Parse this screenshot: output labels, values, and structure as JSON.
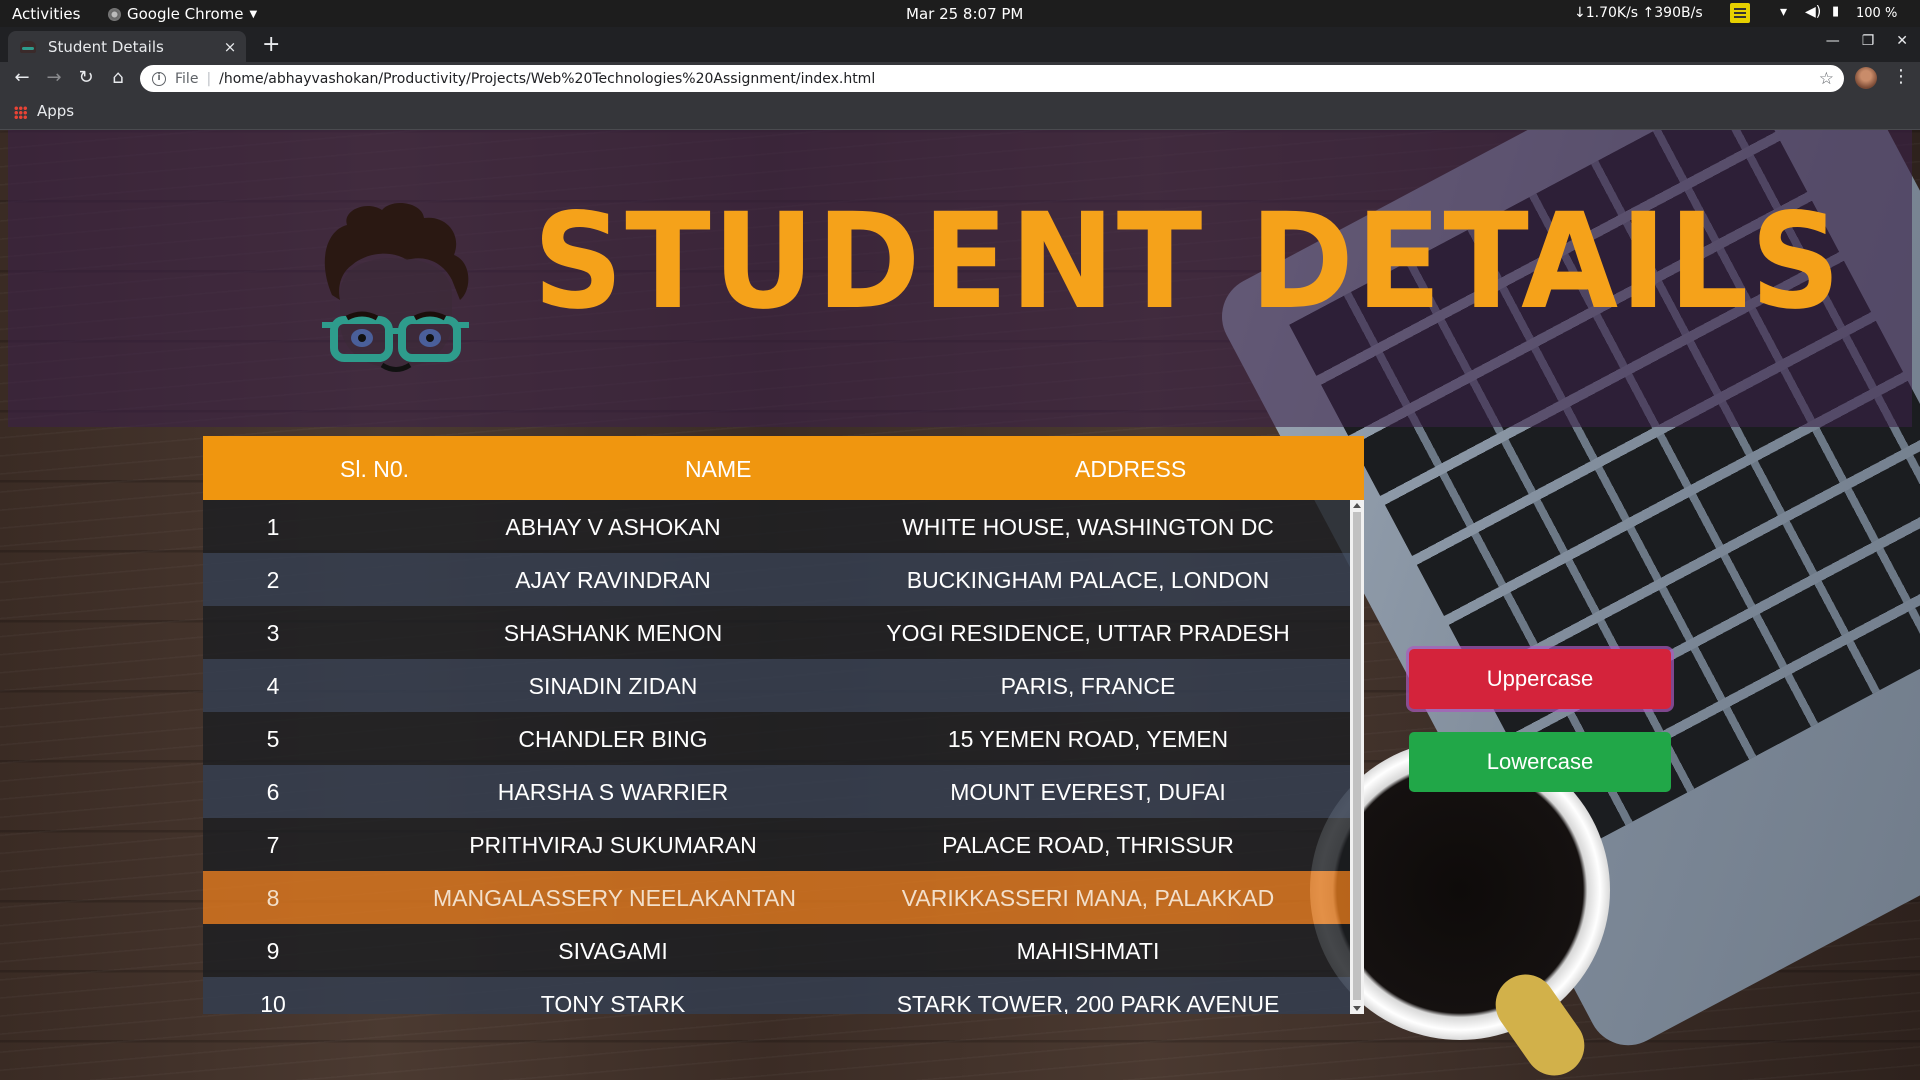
{
  "system_bar": {
    "activities": "Activities",
    "app_name": "Google Chrome",
    "clock": "Mar 25  8:07 PM",
    "network": "↓1.70K/s ↑390B/s",
    "battery": "100 %"
  },
  "browser": {
    "tab_title": "Student Details",
    "tab_close": "×",
    "new_tab": "+",
    "scheme": "File",
    "url": "/home/abhayvashokan/Productivity/Projects/Web%20Technologies%20Assignment/index.html",
    "bookmarks": {
      "apps": "Apps"
    }
  },
  "page": {
    "title": "STUDENT DETAILS",
    "table": {
      "headers": {
        "sl": "Sl. N0.",
        "name": "NAME",
        "address": "ADDRESS"
      },
      "rows": [
        {
          "sl": "1",
          "name": "ABHAY V ASHOKAN",
          "address": "WHITE HOUSE, WASHINGTON DC"
        },
        {
          "sl": "2",
          "name": "AJAY RAVINDRAN",
          "address": "BUCKINGHAM PALACE, LONDON"
        },
        {
          "sl": "3",
          "name": "SHASHANK MENON",
          "address": "YOGI RESIDENCE, UTTAR PRADESH"
        },
        {
          "sl": "4",
          "name": "SINADIN ZIDAN",
          "address": "PARIS, FRANCE"
        },
        {
          "sl": "5",
          "name": "CHANDLER BING",
          "address": "15 YEMEN ROAD, YEMEN"
        },
        {
          "sl": "6",
          "name": "HARSHA S WARRIER",
          "address": "MOUNT EVEREST, DUFAI"
        },
        {
          "sl": "7",
          "name": "PRITHVIRAJ SUKUMARAN",
          "address": "PALACE ROAD, THRISSUR"
        },
        {
          "sl": "8",
          "name": "MANGALASSERY NEELAKANTAN",
          "address": "VARIKKASSERI MANA, PALAKKAD"
        },
        {
          "sl": "9",
          "name": "SIVAGAMI",
          "address": "MAHISHMATI"
        },
        {
          "sl": "10",
          "name": "TONY STARK",
          "address": "STARK TOWER, 200 PARK AVENUE"
        }
      ],
      "highlighted_row": "8"
    },
    "buttons": {
      "uppercase": "Uppercase",
      "lowercase": "Lowercase"
    }
  },
  "colors": {
    "title": "#f5a21a",
    "header_row": "#f0960f",
    "uppercase_button": "#d4233b",
    "lowercase_button": "#21a748"
  }
}
